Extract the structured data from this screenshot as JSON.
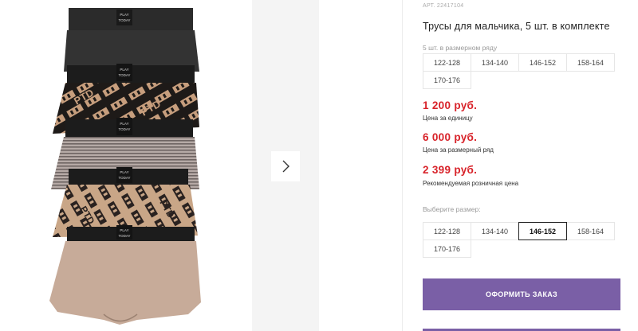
{
  "product": {
    "article": "АРТ. 22417104",
    "title": "Трусы для мальчика, 5 шт. в комплекте",
    "pack_label": "5 шт. в размерном ряду"
  },
  "pack_sizes": [
    "122-128",
    "134-140",
    "146-152",
    "158-164",
    "170-176"
  ],
  "prices": [
    {
      "value": "1 200 руб.",
      "note": "Цена за единицу"
    },
    {
      "value": "6 000 руб.",
      "note": "Цена за размерный ряд"
    },
    {
      "value": "2 399 руб.",
      "note": "Рекомендуемая розничная цена"
    }
  ],
  "size_selector": {
    "label": "Выберите размер:",
    "options": [
      "122-128",
      "134-140",
      "146-152",
      "158-164",
      "170-176"
    ],
    "selected": "146-152"
  },
  "order_button": "ОФОРМИТЬ ЗАКАЗ",
  "image": {
    "logo_line1": "PLAY",
    "logo_line2": "TODAY",
    "print_text": "PTD"
  },
  "colors": {
    "price_red": "#d8232a",
    "accent_purple": "#7a5fa6",
    "selected_border": "#222222"
  },
  "icons": {
    "next_arrow": "chevron-right-icon"
  }
}
